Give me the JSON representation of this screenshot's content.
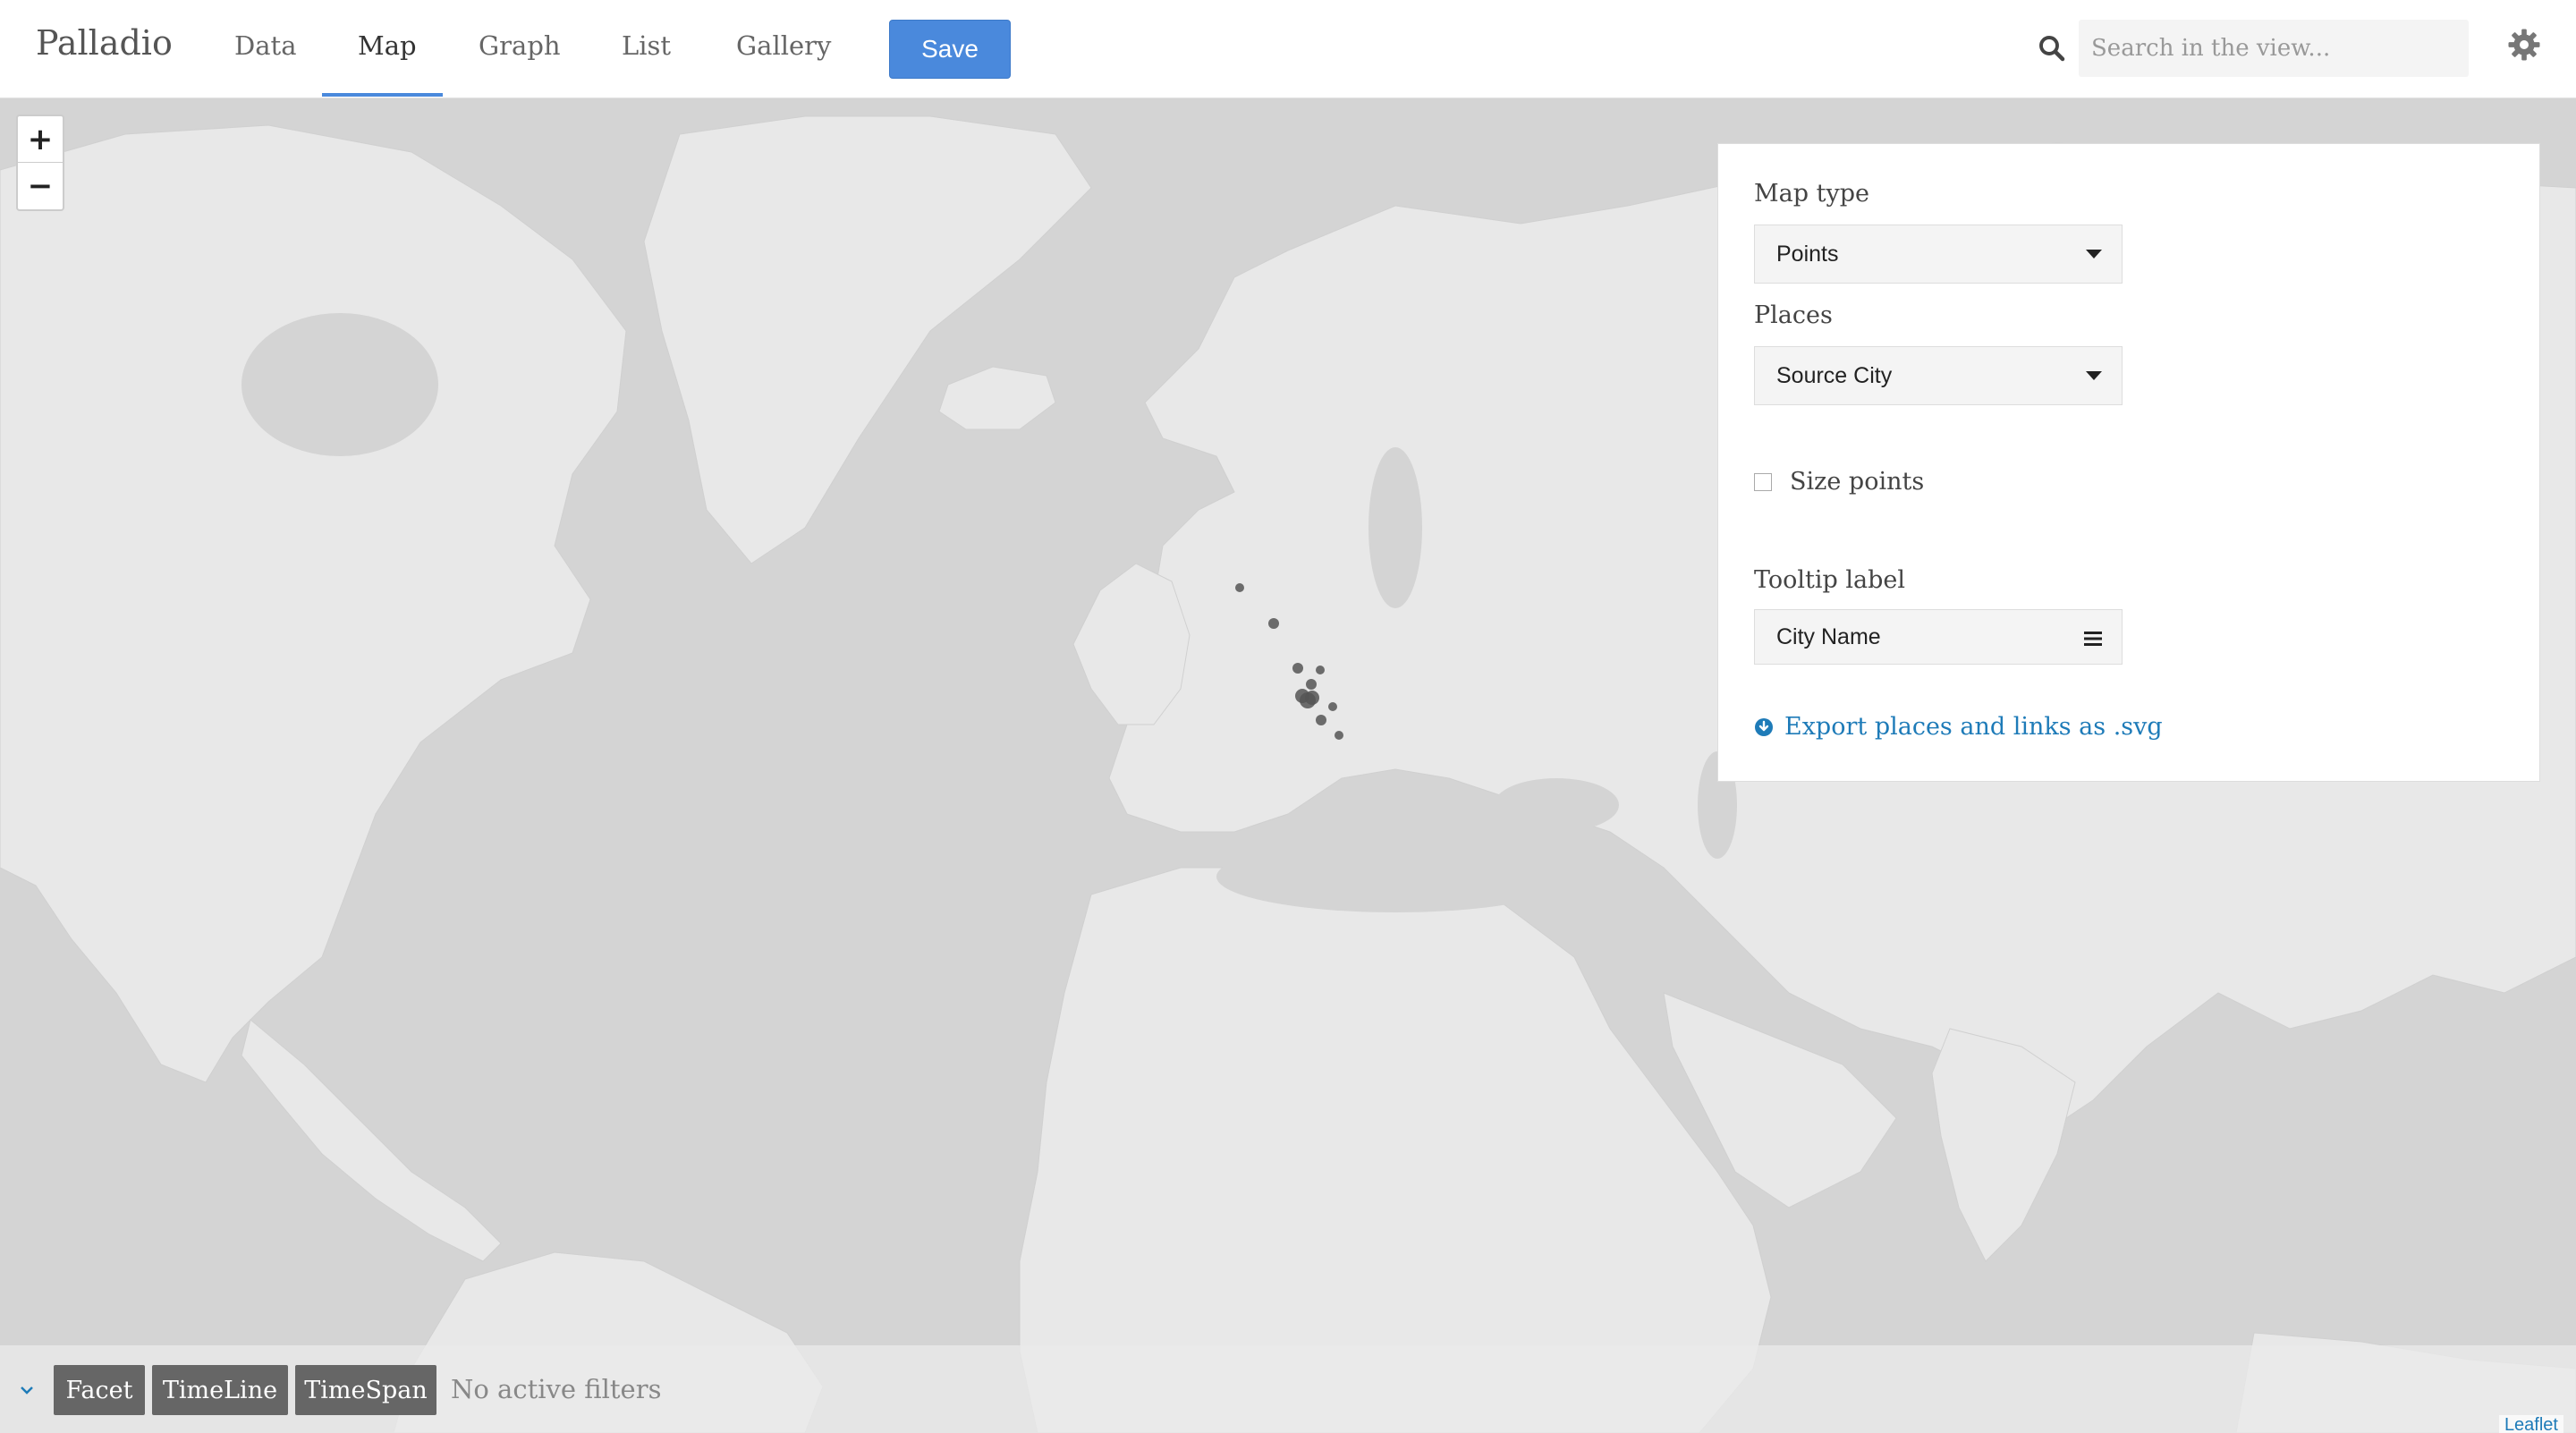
{
  "app": {
    "brand": "Palladio"
  },
  "nav": {
    "tabs": [
      {
        "label": "Data"
      },
      {
        "label": "Map"
      },
      {
        "label": "Graph"
      },
      {
        "label": "List"
      },
      {
        "label": "Gallery"
      }
    ],
    "active_tab": "Map",
    "save_label": "Save"
  },
  "search": {
    "placeholder": "Search in the view..."
  },
  "map": {
    "zoom_in": "+",
    "zoom_out": "−",
    "attribution": "Leaflet"
  },
  "panel": {
    "map_type_label": "Map type",
    "map_type_value": "Points",
    "places_label": "Places",
    "places_value": "Source City",
    "size_points_label": "Size points",
    "size_points_checked": false,
    "tooltip_label": "Tooltip label",
    "tooltip_value": "City Name",
    "export_label": "Export places and links as .svg"
  },
  "filters": {
    "buttons": [
      {
        "label": "Facet"
      },
      {
        "label": "TimeLine"
      },
      {
        "label": "TimeSpan"
      }
    ],
    "status": "No active filters"
  },
  "colors": {
    "accent": "#4a89dc",
    "link": "#1e7bb8",
    "ocean": "#d4d4d4",
    "land": "#e8e8e8",
    "point": "#555555"
  }
}
